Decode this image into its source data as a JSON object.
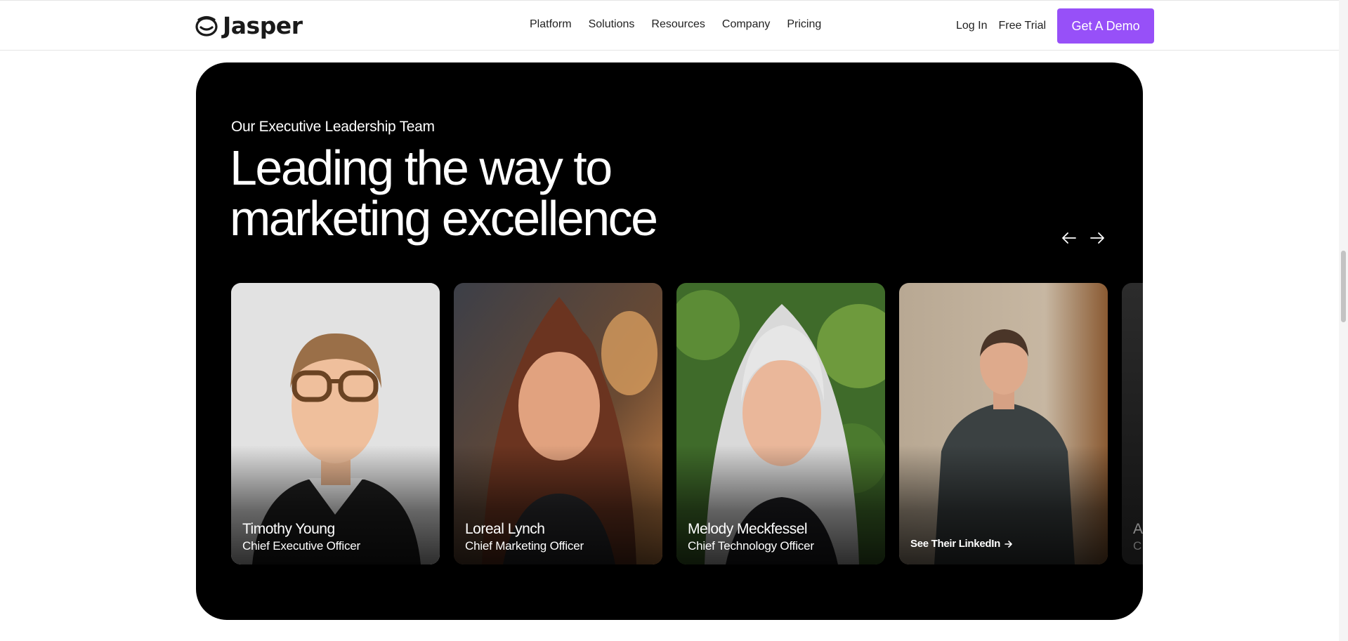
{
  "header": {
    "logo_text": "Jasper",
    "nav": [
      "Platform",
      "Solutions",
      "Resources",
      "Company",
      "Pricing"
    ],
    "login_label": "Log In",
    "free_trial_label": "Free Trial",
    "demo_label": "Get A Demo",
    "accent_color": "#9750f8"
  },
  "section": {
    "eyebrow": "Our Executive Leadership Team",
    "headline_line1": "Leading the way to",
    "headline_line2": "marketing excellence",
    "prev_icon": "arrow-left-icon",
    "next_icon": "arrow-right-icon"
  },
  "cards": [
    {
      "name": "Timothy Young",
      "role": "Chief Executive Officer"
    },
    {
      "name": "Loreal Lynch",
      "role": "Chief Marketing Officer"
    },
    {
      "name": "Melody Meckfessel",
      "role": "Chief Technology Officer"
    },
    {
      "linkedin_label": "See Their LinkedIn"
    },
    {
      "name_fragment": "A",
      "role_fragment": "C"
    }
  ]
}
